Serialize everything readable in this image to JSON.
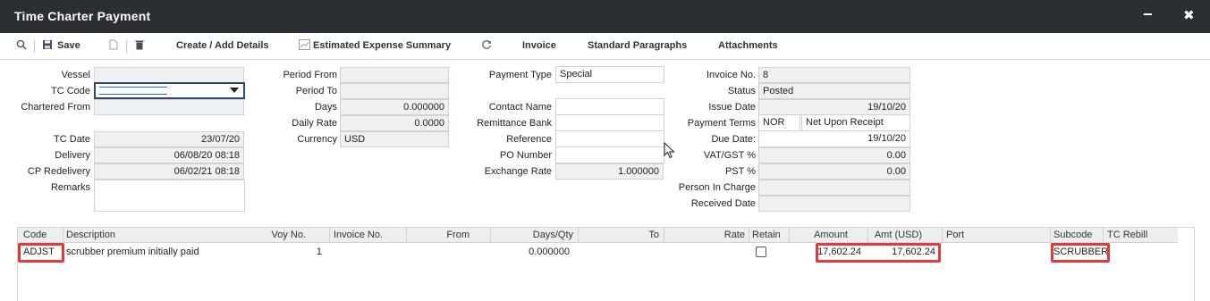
{
  "window": {
    "title": "Time Charter Payment",
    "minimize": "−",
    "close": "✖"
  },
  "toolbar": {
    "save": "Save",
    "create_add_details": "Create / Add Details",
    "estimated_expense_summary": "Estimated Expense Summary",
    "invoice": "Invoice",
    "standard_paragraphs": "Standard Paragraphs",
    "attachments": "Attachments"
  },
  "form": {
    "vessel": {
      "label": "Vessel",
      "value": ""
    },
    "tc_code": {
      "label": "TC Code",
      "value": ""
    },
    "chartered_from": {
      "label": "Chartered From",
      "value": ""
    },
    "tc_date": {
      "label": "TC Date",
      "value": "23/07/20"
    },
    "delivery": {
      "label": "Delivery",
      "value": "06/08/20 08:18"
    },
    "cp_redelivery": {
      "label": "CP Redelivery",
      "value": "06/02/21 08:18"
    },
    "remarks": {
      "label": "Remarks",
      "value": ""
    },
    "period_from": {
      "label": "Period From",
      "value": ""
    },
    "period_to": {
      "label": "Period To",
      "value": ""
    },
    "days": {
      "label": "Days",
      "value": "0.000000"
    },
    "daily_rate": {
      "label": "Daily Rate",
      "value": "0.0000"
    },
    "currency": {
      "label": "Currency",
      "value": "USD"
    },
    "payment_type": {
      "label": "Payment Type",
      "value": "Special"
    },
    "contact_name": {
      "label": "Contact Name",
      "value": ""
    },
    "remittance_bank": {
      "label": "Remittance Bank",
      "value": ""
    },
    "reference": {
      "label": "Reference",
      "value": ""
    },
    "po_number": {
      "label": "PO Number",
      "value": ""
    },
    "exchange_rate": {
      "label": "Exchange Rate",
      "value": "1.000000"
    },
    "invoice_no": {
      "label": "Invoice No.",
      "value": "8"
    },
    "status": {
      "label": "Status",
      "value": "Posted"
    },
    "issue_date": {
      "label": "Issue Date",
      "value": "19/10/20"
    },
    "payment_terms": {
      "label": "Payment Terms",
      "code": "NOR",
      "value": "Net Upon Receipt"
    },
    "due_date": {
      "label": "Due Date:",
      "value": "19/10/20"
    },
    "vat_gst": {
      "label": "VAT/GST %",
      "value": "0.00"
    },
    "pst": {
      "label": "PST %",
      "value": "0.00"
    },
    "person_in_charge": {
      "label": "Person In Charge",
      "value": ""
    },
    "received_date": {
      "label": "Received Date",
      "value": ""
    }
  },
  "grid": {
    "columns": [
      "Code",
      "Description",
      "Voy No.",
      "Invoice No.",
      "From",
      "Days/Qty",
      "To",
      "Rate",
      "Retain",
      "Amount",
      "Amt (USD)",
      "Port",
      "Subcode",
      "TC Rebill"
    ],
    "rows": [
      {
        "code": "ADJST",
        "description": "scrubber premium initially paid",
        "voy_no": "1",
        "invoice_no": "",
        "from": "",
        "days_qty": "0.000000",
        "to": "",
        "rate": "",
        "retain": false,
        "amount": "17,602.24",
        "amt_usd": "17,602.24",
        "port": "",
        "subcode": "SCRUBBER",
        "tc_rebill": ""
      }
    ]
  },
  "colors": {
    "titlebar": "#2b2f33",
    "highlight": "#e03a3a",
    "readonly_field": "#eef0f2"
  },
  "icons": [
    "search-icon",
    "save-icon",
    "document-icon",
    "trash-icon",
    "chart-icon",
    "refresh-icon"
  ]
}
